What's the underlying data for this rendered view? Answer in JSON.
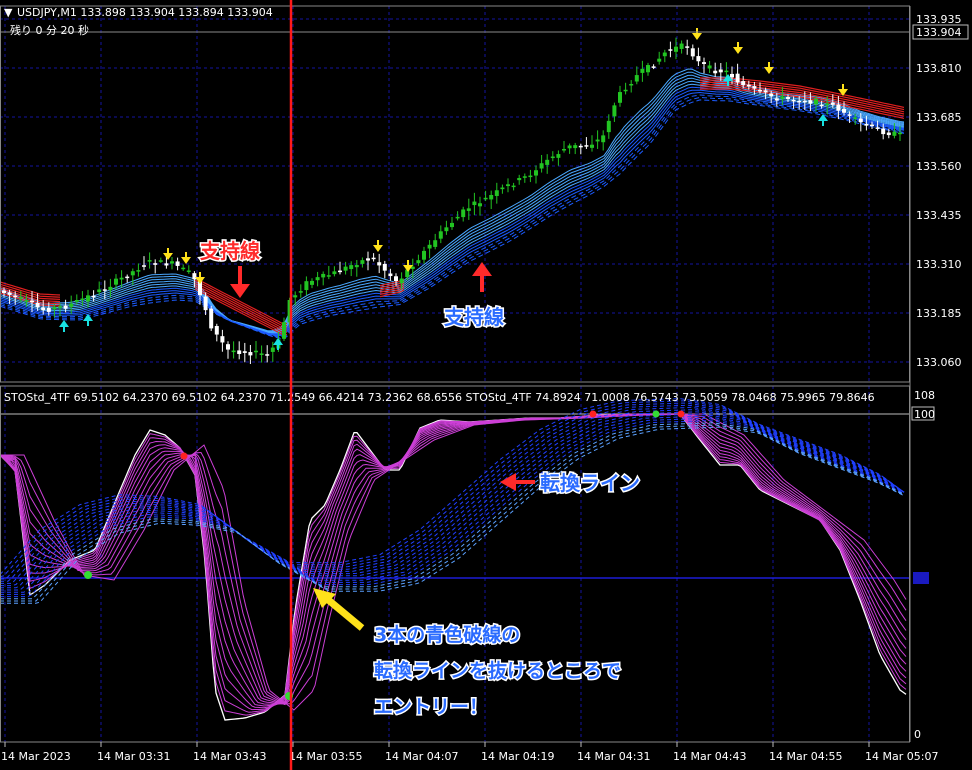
{
  "price_chart": {
    "header": "USDJPY,M1  133.898 133.904 133.894 133.904",
    "countdown": "残り  0 分 20 秒",
    "current_price": "133.904",
    "price_labels": [
      "133.935",
      "133.810",
      "133.685",
      "133.560",
      "133.435",
      "133.310",
      "133.185",
      "133.060"
    ],
    "annotation_red": "支持線",
    "annotation_blue": "支持線"
  },
  "oscillator": {
    "header": "STOStd_4TF 69.5102 64.2370 69.5102 64.2370 71.2549 66.4214 73.2362 68.6556  STOStd_4TF 74.8924 71.0008 76.5743 73.5059 78.0468 75.9965 79.8646",
    "scale_labels": [
      "108",
      "100",
      "0"
    ],
    "annotation_switch": "転換ライン",
    "entry_note": [
      "3本の青色破線の",
      "転換ラインを抜けるところで",
      "エントリー！"
    ]
  },
  "time_axis": [
    "14 Mar 2023",
    "14 Mar 03:31",
    "14 Mar 03:43",
    "14 Mar 03:55",
    "14 Mar 04:07",
    "14 Mar 04:19",
    "14 Mar 04:31",
    "14 Mar 04:43",
    "14 Mar 04:55",
    "14 Mar 05:07"
  ],
  "colors": {
    "background": "#000000",
    "grid": "#1a1aa0",
    "bull_candle": "#22c422",
    "bear_candle": "#ffffff",
    "signal_line": "#ff1a1a",
    "stoch_magenta": "#cc3fd6",
    "stoch_blue": "#2040ff",
    "arrow_yellow": "#ffe21a",
    "arrow_cyan": "#18e0e0",
    "annotation_red": "#ff2a2a",
    "annotation_blue": "#2a6bff"
  }
}
